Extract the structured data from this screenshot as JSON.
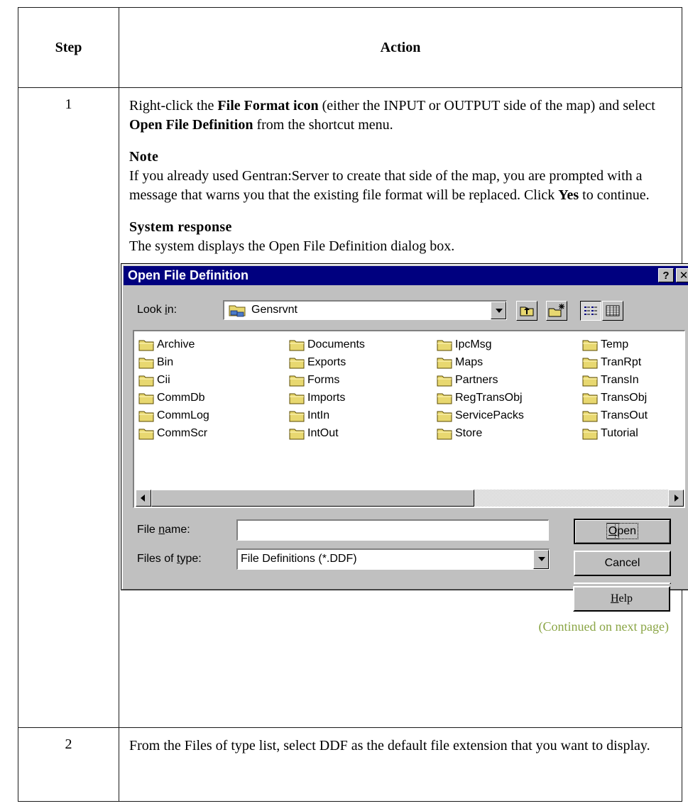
{
  "table": {
    "header_step": "Step",
    "header_action": "Action"
  },
  "step1": {
    "number": "1",
    "intro_prefix": "Right-click the ",
    "intro_bold1": "File Format icon",
    "intro_mid": " (either the INPUT or OUTPUT side of the map) and select ",
    "intro_bold2": "Open File Definition",
    "intro_suffix": " from the shortcut menu.",
    "note_heading": "Note",
    "note_text_prefix": "If you already used Gentran:Server to create that side of the map, you are prompted with a message that warns you that the existing file format will be replaced. Click ",
    "note_bold": "Yes",
    "note_text_suffix": " to continue.",
    "response_heading": "System response",
    "response_text": "The system displays the Open File Definition dialog box.",
    "continued": "(Continued on next page)"
  },
  "dialog": {
    "title": "Open File Definition",
    "help_glyph": "?",
    "close_glyph": "✕",
    "look_in_label_pre": "Look ",
    "look_in_label_u": "i",
    "look_in_label_post": "n:",
    "look_in_value": "Gensrvnt",
    "folders_col1": [
      "Archive",
      "Bin",
      "Cii",
      "CommDb",
      "CommLog",
      "CommScr"
    ],
    "folders_col2": [
      "Documents",
      "Exports",
      "Forms",
      "Imports",
      "IntIn",
      "IntOut"
    ],
    "folders_col3": [
      "IpcMsg",
      "Maps",
      "Partners",
      "RegTransObj",
      "ServicePacks",
      "Store"
    ],
    "folders_col4": [
      "Temp",
      "TranRpt",
      "TransIn",
      "TransObj",
      "TransOut",
      "Tutorial"
    ],
    "file_name_label_pre": "File ",
    "file_name_label_u": "n",
    "file_name_label_post": "ame:",
    "file_name_value": "",
    "files_of_type_label_pre": "Files of ",
    "files_of_type_label_u": "t",
    "files_of_type_label_post": "ype:",
    "files_of_type_value": "File Definitions (*.DDF)",
    "open_button_u": "O",
    "open_button_rest": "pen",
    "cancel_button": "Cancel",
    "help_button_u": "H",
    "help_button_rest": "elp",
    "icons": {
      "up_folder": "up-one-level-icon",
      "new_folder": "create-new-folder-icon",
      "list_view": "list-view-icon",
      "details_view": "details-view-icon"
    }
  },
  "step2": {
    "number": "2",
    "text": "From the Files of type list, select DDF as the default file extension that you want to display."
  },
  "colors": {
    "titlebar": "#00007f",
    "dialog_face": "#c0c0c0",
    "continued_text": "#8aa545"
  }
}
